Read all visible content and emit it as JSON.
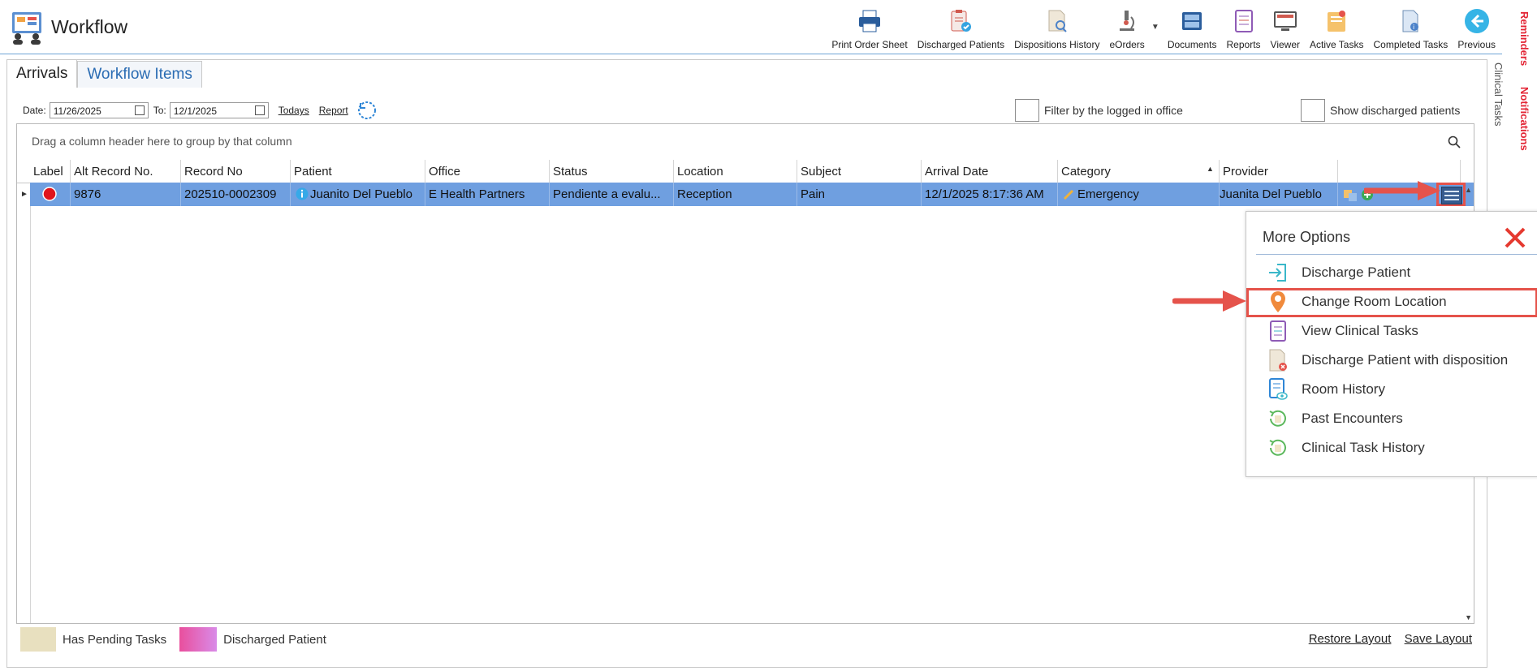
{
  "app": {
    "title": "Workflow"
  },
  "toolbar": [
    {
      "label": "Print Order Sheet",
      "icon": "printer-icon"
    },
    {
      "label": "Discharged Patients",
      "icon": "clipboard-check-icon"
    },
    {
      "label": "Dispositions History",
      "icon": "document-search-icon"
    },
    {
      "label": "eOrders",
      "icon": "microscope-icon"
    },
    {
      "label": "Documents",
      "icon": "file-tray-icon"
    },
    {
      "label": "Reports",
      "icon": "report-list-icon"
    },
    {
      "label": "Viewer",
      "icon": "monitor-icon"
    },
    {
      "label": "Active Tasks",
      "icon": "task-folder-icon"
    },
    {
      "label": "Completed Tasks",
      "icon": "completed-document-icon"
    },
    {
      "label": "Previous",
      "icon": "back-arrow-icon"
    }
  ],
  "side": {
    "reminders": "Reminders",
    "notifications": "Notifications",
    "clinical_tasks": "Clinical Tasks"
  },
  "tabs": [
    {
      "label": "Arrivals"
    },
    {
      "label": "Workflow Items"
    }
  ],
  "filters": {
    "date_label": "Date:",
    "date_from": "11/26/2025",
    "to_label": "To:",
    "date_to": "12/1/2025",
    "todays": "Todays",
    "report": "Report",
    "filter_office": "Filter by the logged in office",
    "show_discharged": "Show discharged patients"
  },
  "grid": {
    "group_hint": "Drag a column header here to group by that column",
    "columns": [
      "Label",
      "Alt Record No.",
      "Record No",
      "Patient",
      "Office",
      "Status",
      "Location",
      "Subject",
      "Arrival Date",
      "Category",
      "Provider"
    ],
    "row": {
      "label_color": "#e0151c",
      "alt_record_no": "9876",
      "record_no": "202510-0002309",
      "patient": "Juanito Del Pueblo",
      "office": "E Health Partners",
      "status": "Pendiente a evalu...",
      "location": "Reception",
      "subject": "Pain",
      "arrival_date": "12/1/2025 8:17:36 AM",
      "category": "Emergency",
      "provider": "Juanita Del Pueblo"
    }
  },
  "legend": [
    {
      "label": "Has Pending Tasks",
      "color": "#e8e0bf"
    },
    {
      "label": "Discharged Patient",
      "color": "#e26ccd"
    }
  ],
  "footer": {
    "restore": "Restore Layout",
    "save": "Save Layout"
  },
  "popup": {
    "title": "More Options",
    "items": [
      {
        "label": "Discharge Patient",
        "icon": "discharge-arrow-icon"
      },
      {
        "label": "Change Room Location",
        "icon": "map-pin-icon"
      },
      {
        "label": "View Clinical Tasks",
        "icon": "checklist-icon"
      },
      {
        "label": "Discharge Patient with disposition",
        "icon": "document-x-icon"
      },
      {
        "label": "Room History",
        "icon": "room-history-icon"
      },
      {
        "label": "Past Encounters",
        "icon": "history-cycle-icon"
      },
      {
        "label": "Clinical Task History",
        "icon": "task-history-icon"
      }
    ]
  },
  "colors": {
    "selected_row": "#6f9fe0",
    "accent": "#2a6cb3",
    "annotation": "#e5534b"
  }
}
